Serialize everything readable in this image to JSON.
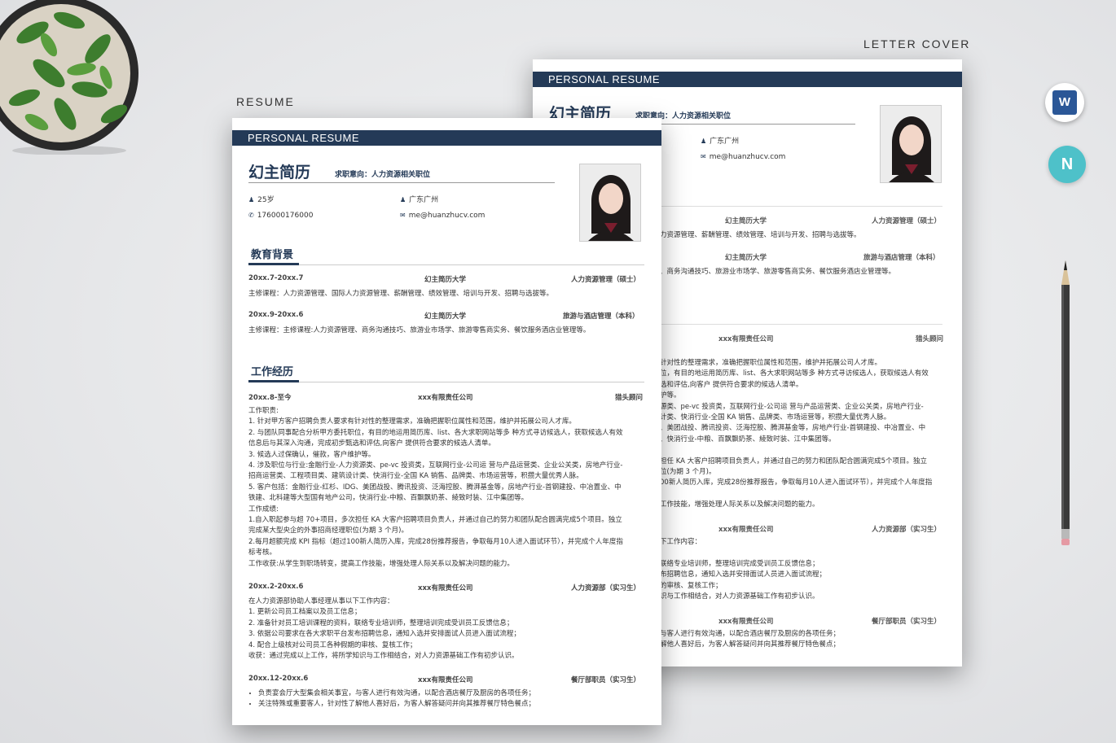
{
  "labels": {
    "resume": "RESUME",
    "letter": "LETTER COVER"
  },
  "colors": {
    "accent": "#243a57",
    "icon_teal": "#4ec1c9",
    "word_blue": "#2b5797"
  },
  "icons": {
    "word": "word-app-icon",
    "other": "n-app-icon"
  },
  "front": {
    "band": "PERSONAL RESUME",
    "name": "幻主简历",
    "intent": "求职意向：人力资源相关职位",
    "age": "25岁",
    "city": "广东广州",
    "phone": "176000176000",
    "email": "me@huanzhucv.com",
    "edu_title": "教育背景",
    "edu": [
      {
        "date": "20xx.7-20xx.7",
        "school": "幻主简历大学",
        "major": "人力资源管理（硕士）",
        "desc": "主修课程：人力资源管理、国际人力资源管理、薪酬管理、绩效管理、培训与开发、招聘与选拔等。"
      },
      {
        "date": "20xx.9-20xx.6",
        "school": "幻主简历大学",
        "major": "旅游与酒店管理（本科）",
        "desc": "主修课程：主修课程:人力资源管理、商务沟通技巧、旅游业市场学、旅游零售商实务、餐饮服务酒店业管理等。"
      }
    ],
    "work_title": "工作经历",
    "work1": {
      "date": "20xx.8-至今",
      "company": "xxx有限责任公司",
      "role": "猎头顾问",
      "lines": [
        "工作职责:",
        "1. 针对甲方客户招聘负责人要求有针对性的整理需求，准确把握职位属性和范围，维护并拓展公司人才库。",
        "2. 与团队同事配合分析甲方委托职位，有目的地运用简历库、list、各大求职网站等多 种方式寻访候选人，获取候选人有效",
        "信息后与其深入沟通，完成初步甄选和评估,向客户 提供符合要求的候选人清单。",
        "3. 候选人过保确认，催款，客户维护等。",
        "4. 涉及职位与行业:金融行业-人力资源类、pe-vc 投资类，互联网行业-公司运 营与产品运营类、企业公关类，房地产行业-",
        "招商运营类、工程项目类、建筑设计类、快消行业-全国 KA 销售、品牌类、市场运营等，积攒大量优秀人脉。",
        "5. 客户包括：金融行业-红杉、IDG、美团战投、腾讯投资、泛海控股、腾湃基金等，房地产行业-首钢建投、中冶置业、中",
        "铁建、北科建等大型国有地产公司，快消行业-中粮、百飘飘奶茶、綾致时装、江中集团等。",
        "工作成绩:",
        "1.自入职起参与超 70+项目，多次担任 KA 大客户招聘项目负责人，并通过自己的努力和团队配合圆满完成5个项目。独立",
        "完成某大型央企的外事招商经理职位(为期 3 个月)。",
        "2.每月超额完成 KPI 指标（超过100新人简历入库，完成28份推荐报告，争取每月10人进入面试环节），并完成个人年度指",
        "标考核。",
        "工作收获:从学生到职场转变，提高工作技能，增强处理人际关系以及解决问题的能力。"
      ]
    },
    "work2": {
      "date": "20xx.2-20xx.6",
      "company": "xxx有限责任公司",
      "role": "人力资源部（实习生）",
      "lines": [
        "在人力资源部协助人事经理从事以下工作内容：",
        "1. 更新公司员工档案以及员工信息；",
        "2. 准备针对员工培训课程的资料，联络专业培训师，整理培训完成受训员工反馈信息；",
        "3. 依据公司要求在各大求职平台发布招聘信息，通知入选并安排面试人员进入面试流程；",
        "4. 配合上级核对公司员工各种假期的审核、复核工作；",
        "收获：通过完成以上工作，将所学知识与工作相结合，对人力资源基础工作有初步认识。"
      ]
    },
    "work3": {
      "date": "20xx.12-20xx.6",
      "company": "xxx有限责任公司",
      "role": "餐厅部职员（实习生）",
      "bullets": [
        "负责宴会厅大型集会相关事宜，与客人进行有效沟通，以配合酒店餐厅及厨房的各项任务；",
        "关注特殊或重要客人，针对性了解他人喜好后，为客人解答疑问并向其推荐餐厅特色餐点；"
      ]
    }
  },
  "back": {
    "band": "PERSONAL RESUME",
    "name": "幻主简历",
    "intent": "求职意向：人力资源相关职位",
    "city": "广东广州",
    "email": "me@huanzhucv.com",
    "rows": [
      {
        "c": "幻主简历大学",
        "r": "人力资源管理（硕士）"
      },
      {
        "c": "幻主简历大学",
        "r": "旅游与酒店管理（本科）"
      },
      {
        "c": "xxx有限责任公司",
        "r": "猎头顾问"
      },
      {
        "c": "xxx有限责任公司",
        "r": "人力资源部（实习生）"
      },
      {
        "c": "xxx有限责任公司",
        "r": "餐厅部职员（实习生）"
      }
    ],
    "t1": "力资源管理、薪酬管理、绩效管理、培训与开发、招聘与选拔等。",
    "t2": "、商务沟通技巧、旅游业市场学、旅游零售商实务、餐饮服务酒店业管理等。",
    "w1": [
      "针对性的整理需求，准确把握职位属性和范围，维护并拓展公司人才库。",
      "位，有目的地运用简历库、list、各大求职网站等多 种方式寻访候选人，获取候选人有效",
      "选和评估,向客户 提供符合要求的候选人清单。",
      "护等。",
      "源类、pe-vc 投资类，互联网行业-公司运 营与产品运营类、企业公关类，房地产行业-",
      "计类、快消行业-全国 KA 销售、品牌类、市场运营等，积攒大量优秀人脉。",
      "、美团战投、腾讯投资、泛海控股、腾湃基金等，房地产行业-首钢建投、中冶置业、中",
      "、快消行业-中粮、百飘飘奶茶、綾致时装、江中集团等。",
      "",
      "担任 KA 大客户招聘项目负责人，并通过自己的努力和团队配合圆满完成5个项目。独立",
      "位(为期 3 个月)。",
      "00新人简历入库，完成28份推荐报告，争取每月10人进入面试环节），并完成个人年度指",
      "",
      "工作技能，增强处理人际关系以及解决问题的能力。"
    ],
    "w2": [
      "下工作内容：",
      "",
      "联络专业培训师，整理培训完成受训员工反馈信息；",
      "布招聘信息，通知入选并安排面试人员进入面试流程；",
      "的审核、复核工作；",
      "识与工作相结合，对人力资源基础工作有初步认识。"
    ],
    "w3": [
      "与客人进行有效沟通，以配合酒店餐厅及厨房的各项任务；",
      "解他人喜好后，为客人解答疑问并向其推荐餐厅特色餐点；"
    ]
  }
}
